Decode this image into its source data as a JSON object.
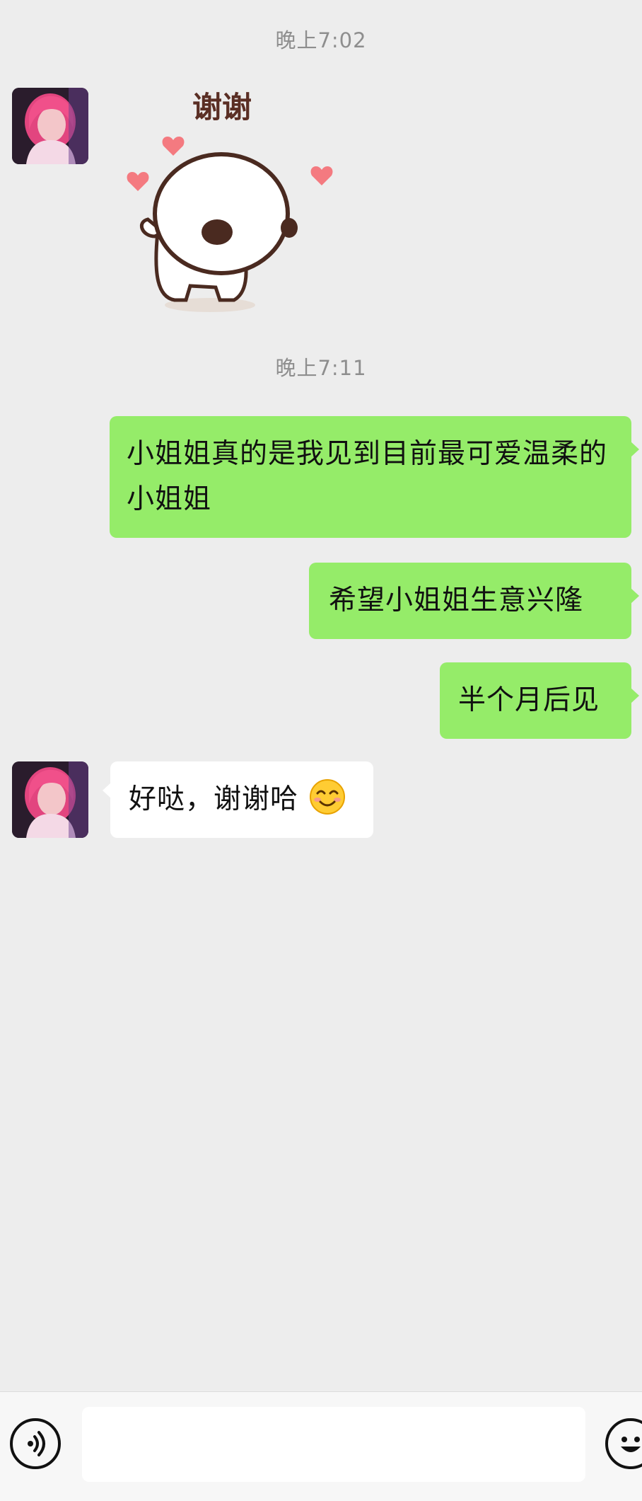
{
  "conversation": {
    "timestamp_1": "晚上7:02",
    "timestamp_2": "晚上7:11",
    "sticker_text": "谢谢",
    "messages": [
      {
        "from": "me",
        "text": "小姐姐真的是我见到目前最可爱温柔的小姐姐"
      },
      {
        "from": "me",
        "text": "希望小姐姐生意兴隆"
      },
      {
        "from": "me",
        "text": "半个月后见"
      },
      {
        "from": "them",
        "text": "好哒，谢谢哈",
        "emoji": "smiling-face-emoji"
      }
    ]
  },
  "input_bar": {
    "voice_icon": "voice-icon",
    "emoji_icon": "emoji-icon",
    "text_value": ""
  },
  "colors": {
    "background": "#ededed",
    "my_bubble": "#95ec69",
    "their_bubble": "#ffffff",
    "timestamp_text": "#8e8e8e"
  }
}
